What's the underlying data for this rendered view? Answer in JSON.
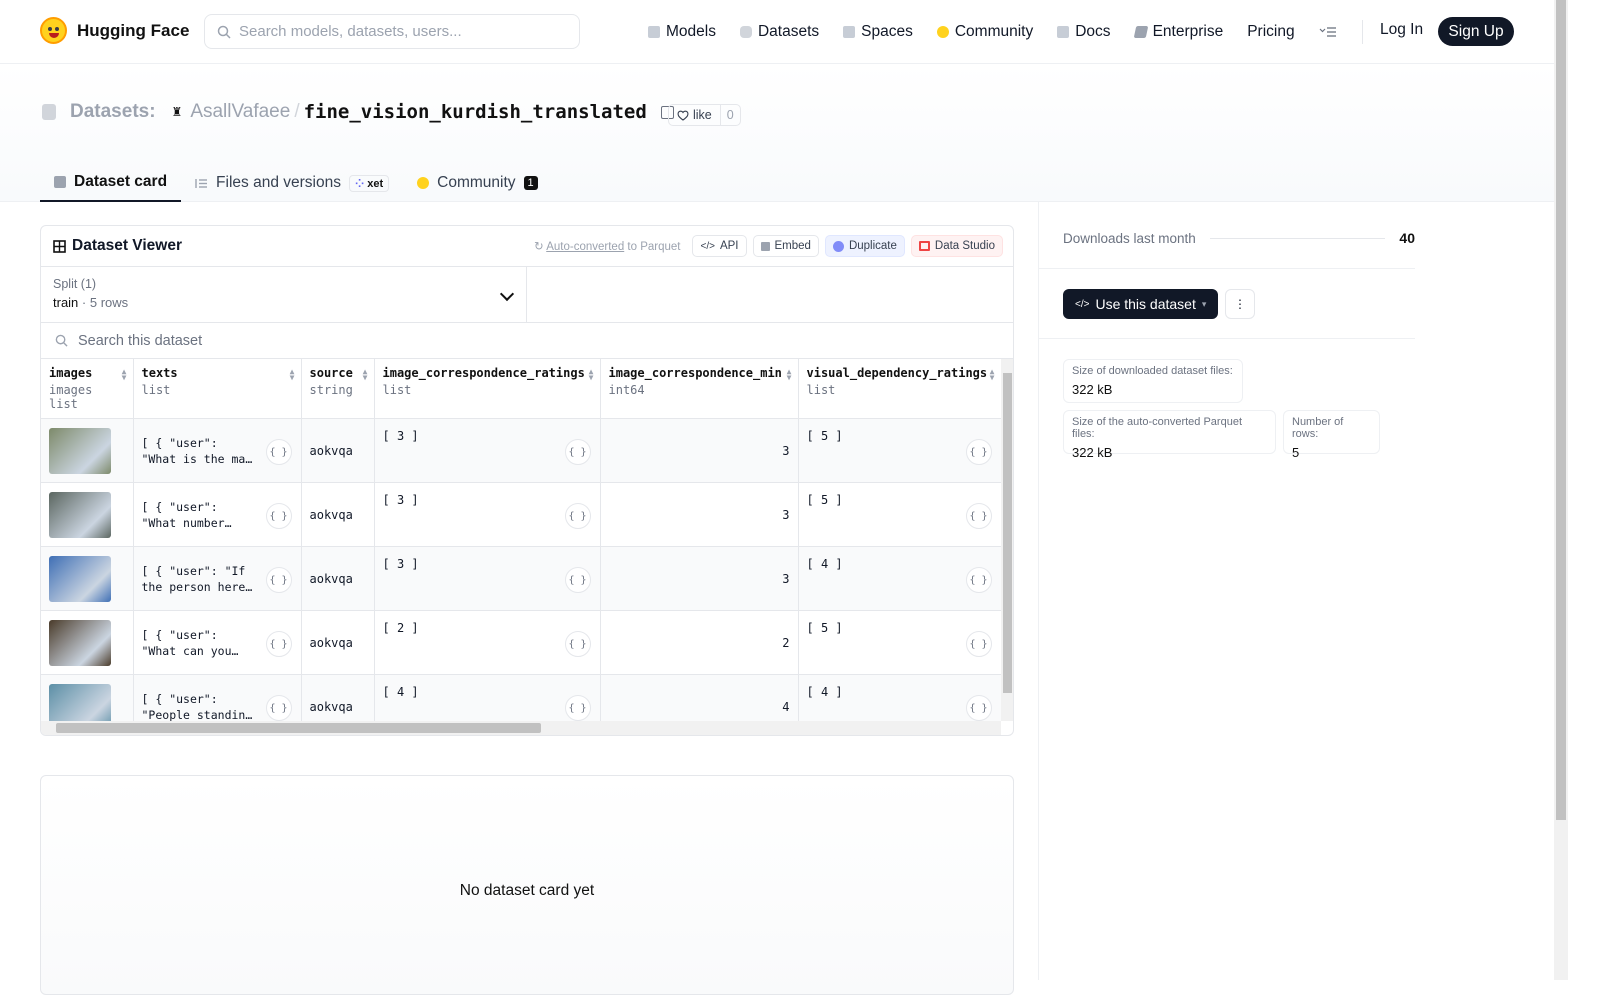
{
  "nav": {
    "brand": "Hugging Face",
    "search_placeholder": "Search models, datasets, users...",
    "links": [
      "Models",
      "Datasets",
      "Spaces",
      "Community",
      "Docs",
      "Enterprise",
      "Pricing"
    ],
    "login": "Log In",
    "signup": "Sign Up"
  },
  "header": {
    "section": "Datasets:",
    "user": "AsallVafaee",
    "slash": "/",
    "dataset": "fine_vision_kurdish_translated",
    "like_label": "like",
    "like_count": "0",
    "tabs": {
      "card": "Dataset card",
      "files": "Files and versions",
      "xet": "xet",
      "community": "Community",
      "community_count": "1"
    }
  },
  "viewer": {
    "title": "Dataset Viewer",
    "auto_converted": "Auto-converted",
    "to_parquet": " to Parquet",
    "api": "API",
    "embed": "Embed",
    "duplicate": "Duplicate",
    "data_studio": "Data Studio",
    "split_label": "Split (1)",
    "split_value": "train",
    "split_rows": "5 rows",
    "search_placeholder": "Search this dataset",
    "columns": [
      {
        "name": "images",
        "type": "images list"
      },
      {
        "name": "texts",
        "type": "list"
      },
      {
        "name": "source",
        "type": "string"
      },
      {
        "name": "image_correspondence_ratings",
        "type": "list"
      },
      {
        "name": "image_correspondence_min",
        "type": "int64"
      },
      {
        "name": "visual_dependency_ratings",
        "type": "list"
      }
    ],
    "rows": [
      {
        "thumb": "#7d8a6a",
        "texts": "[ { \"user\":\n\"What is the ma…",
        "source": "aokvqa",
        "icr": "[ 3 ]",
        "icm": "3",
        "vdr": "[ 5 ]"
      },
      {
        "thumb": "#5b6660",
        "texts": "[ { \"user\":\n\"What number…",
        "source": "aokvqa",
        "icr": "[ 3 ]",
        "icm": "3",
        "vdr": "[ 5 ]"
      },
      {
        "thumb": "#3f6fb5",
        "texts": "[ { \"user\": \"If\nthe person here…",
        "source": "aokvqa",
        "icr": "[ 3 ]",
        "icm": "3",
        "vdr": "[ 4 ]"
      },
      {
        "thumb": "#4a3b2a",
        "texts": "[ { \"user\":\n\"What can you…",
        "source": "aokvqa",
        "icr": "[ 2 ]",
        "icm": "2",
        "vdr": "[ 5 ]"
      },
      {
        "thumb": "#5c8fa6",
        "texts": "[ { \"user\":\n\"People standin…",
        "source": "aokvqa",
        "icr": "[ 4 ]",
        "icm": "4",
        "vdr": "[ 4 ]"
      }
    ]
  },
  "card": {
    "empty": "No dataset card yet"
  },
  "sidebar": {
    "downloads_label": "Downloads last month",
    "downloads_value": "40",
    "use_button": "Use this dataset",
    "size_downloaded_label": "Size of downloaded dataset files:",
    "size_downloaded_value": "322 kB",
    "size_parquet_label": "Size of the auto-converted Parquet files:",
    "size_parquet_value": "322 kB",
    "rows_label": "Number of rows:",
    "rows_value": "5"
  }
}
